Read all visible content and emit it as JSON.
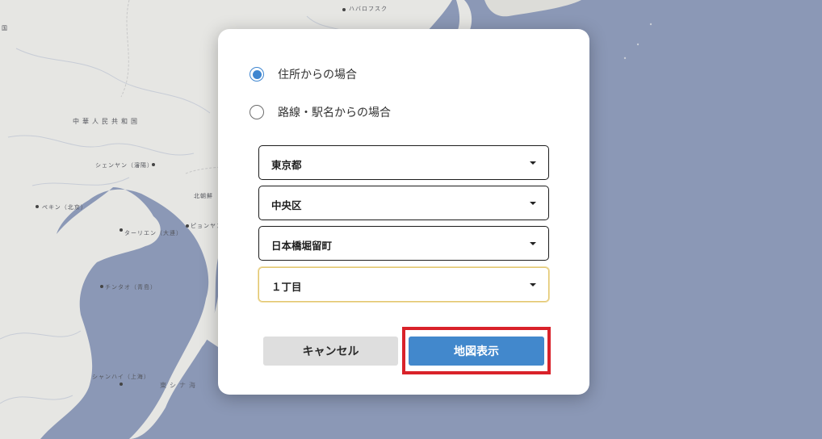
{
  "map": {
    "labels": {
      "khabarovsk": "ハバロフスク",
      "china": "中華人民共和国",
      "shenyang": "シェンヤン（瀋陽）",
      "beijing": "ペキン（北京）",
      "dalian": "ターリエン（大連）",
      "north_korea": "北朝鮮",
      "pyongyang": "ピョンヤン",
      "qingdao": "チンタオ（青島）",
      "shanghai": "シャンハイ（上海）",
      "east_china_sea": "東シナ海",
      "left_edge": "国"
    },
    "colors": {
      "land": "#e6e6e3",
      "sea": "#8b98b6",
      "coast": "#b4bccc"
    }
  },
  "dialog": {
    "radio_options": [
      {
        "label": "住所からの場合",
        "checked": true
      },
      {
        "label": "路線・駅名からの場合",
        "checked": false
      }
    ],
    "selects": [
      {
        "value": "東京都"
      },
      {
        "value": "中央区"
      },
      {
        "value": "日本橋堀留町"
      },
      {
        "value": "１丁目"
      }
    ],
    "cancel_label": "キャンセル",
    "show_map_label": "地図表示"
  },
  "colors": {
    "accent": "#4288cc",
    "highlight": "#d9222a",
    "focus_border": "#e2c66e"
  }
}
